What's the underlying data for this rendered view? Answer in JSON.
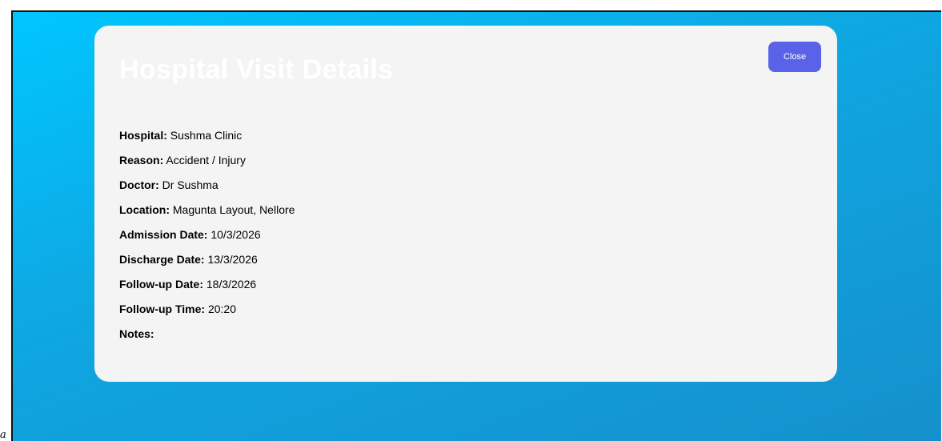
{
  "modal": {
    "title": "Hospital Visit Details",
    "close_label": "Close"
  },
  "details": [
    {
      "label": "Hospital:",
      "value": "Sushma Clinic"
    },
    {
      "label": "Reason:",
      "value": "Accident / Injury"
    },
    {
      "label": "Doctor:",
      "value": "Dr Sushma"
    },
    {
      "label": "Location:",
      "value": "Magunta Layout, Nellore"
    },
    {
      "label": "Admission Date:",
      "value": "10/3/2026"
    },
    {
      "label": "Discharge Date:",
      "value": "13/3/2026"
    },
    {
      "label": "Follow-up Date:",
      "value": "18/3/2026"
    },
    {
      "label": "Follow-up Time:",
      "value": "20:20"
    },
    {
      "label": "Notes:",
      "value": ""
    }
  ],
  "corner_mark": "a",
  "colors": {
    "close_button": "#5a63e8",
    "card_background": "#f4f4f4",
    "gradient_start": "#00c6ff",
    "gradient_end": "#1590cc"
  }
}
